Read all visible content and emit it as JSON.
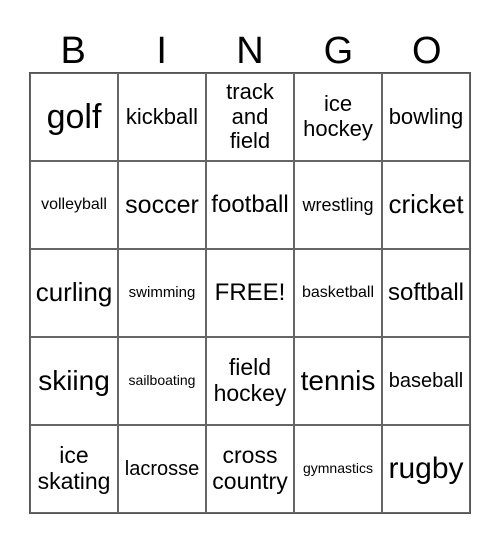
{
  "header": {
    "letters": [
      "B",
      "I",
      "N",
      "G",
      "O"
    ]
  },
  "grid": {
    "rows": [
      [
        {
          "text": "golf",
          "size": 34
        },
        {
          "text": "kickball",
          "size": 22
        },
        {
          "text": "track and field",
          "size": 22,
          "lines": [
            "track",
            "and",
            "field"
          ]
        },
        {
          "text": "ice hockey",
          "size": 22,
          "lines": [
            "ice",
            "hockey"
          ]
        },
        {
          "text": "bowling",
          "size": 22
        }
      ],
      [
        {
          "text": "volleyball",
          "size": 16
        },
        {
          "text": "soccer",
          "size": 25
        },
        {
          "text": "football",
          "size": 24
        },
        {
          "text": "wrestling",
          "size": 18
        },
        {
          "text": "cricket",
          "size": 26
        }
      ],
      [
        {
          "text": "curling",
          "size": 26
        },
        {
          "text": "swimming",
          "size": 15
        },
        {
          "text": "FREE!",
          "size": 24
        },
        {
          "text": "basketball",
          "size": 16
        },
        {
          "text": "softball",
          "size": 24
        }
      ],
      [
        {
          "text": "skiing",
          "size": 28
        },
        {
          "text": "sailboating",
          "size": 14
        },
        {
          "text": "field hockey",
          "size": 23,
          "lines": [
            "field",
            "hockey"
          ]
        },
        {
          "text": "tennis",
          "size": 28
        },
        {
          "text": "baseball",
          "size": 20
        }
      ],
      [
        {
          "text": "ice skating",
          "size": 23,
          "lines": [
            "ice",
            "skating"
          ]
        },
        {
          "text": "lacrosse",
          "size": 20
        },
        {
          "text": "cross country",
          "size": 23,
          "lines": [
            "cross",
            "country"
          ]
        },
        {
          "text": "gymnastics",
          "size": 14
        },
        {
          "text": "rugby",
          "size": 30
        }
      ]
    ]
  }
}
